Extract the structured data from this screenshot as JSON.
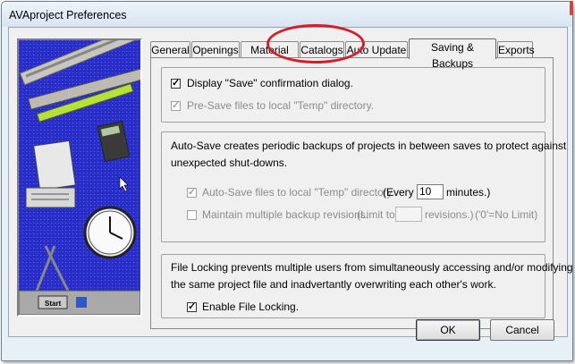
{
  "window": {
    "title": "AVAproject Preferences"
  },
  "tabs": [
    {
      "label": "General"
    },
    {
      "label": "Openings"
    },
    {
      "label": "Material List"
    },
    {
      "label": "Catalogs"
    },
    {
      "label": "Auto Update"
    },
    {
      "label": "Saving & Backups"
    },
    {
      "label": "Exports"
    }
  ],
  "active_tab": "Saving & Backups",
  "group1": {
    "display_save": {
      "label": "Display \"Save\" confirmation dialog.",
      "checked": true
    },
    "pre_save": {
      "label": "Pre-Save files to local \"Temp\" directory.",
      "checked": true,
      "disabled": true
    }
  },
  "group2": {
    "description_line1": "Auto-Save creates periodic backups of projects in between saves to protect against",
    "description_line2": "unexpected shut-downs.",
    "auto_save": {
      "label": "Auto-Save files to local \"Temp\" directory.",
      "checked": true,
      "disabled": true
    },
    "every_prefix": "(Every",
    "every_value": "10",
    "every_suffix": "minutes.)",
    "maintain": {
      "label": "Maintain multiple backup revisions.",
      "checked": false,
      "disabled": true
    },
    "limit_prefix": "(Limit to",
    "limit_value": "",
    "limit_suffix": "revisions.)",
    "limit_note": "('0'=No Limit)"
  },
  "group3": {
    "description_line1": "File Locking prevents multiple users from simultaneously accessing and/or modifying",
    "description_line2": "the same project file and inadvertantly overwriting each other's work.",
    "enable_locking": {
      "label": "Enable File Locking.",
      "checked": true
    }
  },
  "buttons": {
    "ok": "OK",
    "cancel": "Cancel"
  },
  "picture": {
    "start_label": "Start"
  },
  "colors": {
    "annotation": "#d1202a",
    "picture_bg": "#2a2ec9"
  }
}
